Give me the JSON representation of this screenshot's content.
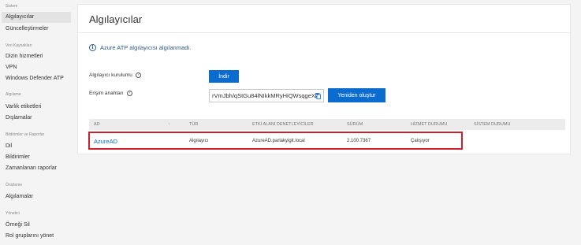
{
  "sidebar": {
    "sections": [
      {
        "label": "Sistem",
        "items": [
          "Algılayıcılar",
          "Güncelleştirmeler"
        ]
      },
      {
        "label": "Veri Kaynakları",
        "items": [
          "Dizin hizmetleri",
          "VPN",
          "Windows Defender ATP"
        ]
      },
      {
        "label": "Algılama",
        "items": [
          "Varlık etiketleri",
          "Dışlamalar"
        ]
      },
      {
        "label": "Bildirimler ve Raporlar",
        "items": [
          "Dil",
          "Bildirimler",
          "Zamanlanan raporlar"
        ]
      },
      {
        "label": "Önizleme",
        "items": [
          "Algılamalar"
        ]
      },
      {
        "label": "Yönetici",
        "items": [
          "Örneği Sil",
          "Rol gruplarını yönet"
        ]
      }
    ]
  },
  "main": {
    "title": "Algılayıcılar",
    "notice": "Azure ATP algılayıcısı algılanmadı.",
    "setup_label": "Algılayıcı kurulumu",
    "download_button": "İndir",
    "access_key_label": "Erişim anahtarı",
    "access_key_value": "rVmJbh/qStGu84lNIkkMRyHiQWsqgeXZ",
    "regenerate_button": "Yeniden oluştur"
  },
  "table": {
    "columns": [
      "AD",
      "TÜR",
      "ETKİ ALANI DENETLEYİCİLER",
      "SÜRÜM",
      "HİZMET DURUMU",
      "SİSTEM DURUMU"
    ],
    "rows": [
      {
        "name": "AzureAD",
        "type": "Algılayıcı",
        "domain_controllers": "AzureAD.parlakyigit.local",
        "version": "2.100.7367",
        "service_status": "Çalışıyor",
        "system_status": ""
      }
    ]
  },
  "colors": {
    "accent": "#0a6ccf",
    "highlight_border": "#cc1f2f"
  }
}
